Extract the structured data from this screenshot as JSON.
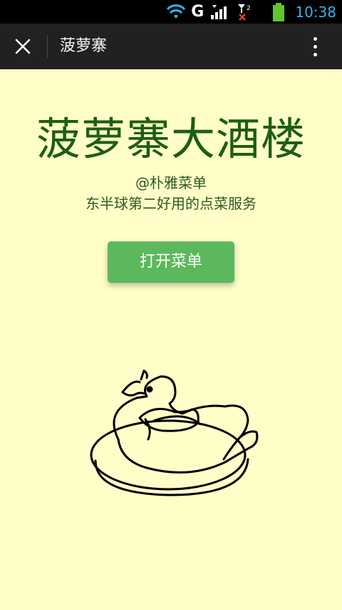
{
  "status_bar": {
    "network_letter": "G",
    "time": "10:38",
    "icons": [
      "wifi-icon",
      "signal-icon",
      "signal-no-sim-icon",
      "battery-icon"
    ],
    "colors": {
      "clock": "#35b3e8",
      "battery": "#63c32f",
      "no_sim_x": "#e53935"
    }
  },
  "app_bar": {
    "title": "菠萝寨",
    "close_icon": "close-icon",
    "more_icon": "more-vert-icon",
    "background": "#212121"
  },
  "main": {
    "headline": "菠萝寨大酒楼",
    "subtitle_line1": "@朴雅菜单",
    "subtitle_line2": "东半球第二好用的点菜服务",
    "open_menu_button": "打开菜单",
    "illustration": "roast-duck-on-plate",
    "colors": {
      "background": "#fffdc8",
      "headline": "#1c5e12",
      "button": "#5cb85c"
    }
  }
}
